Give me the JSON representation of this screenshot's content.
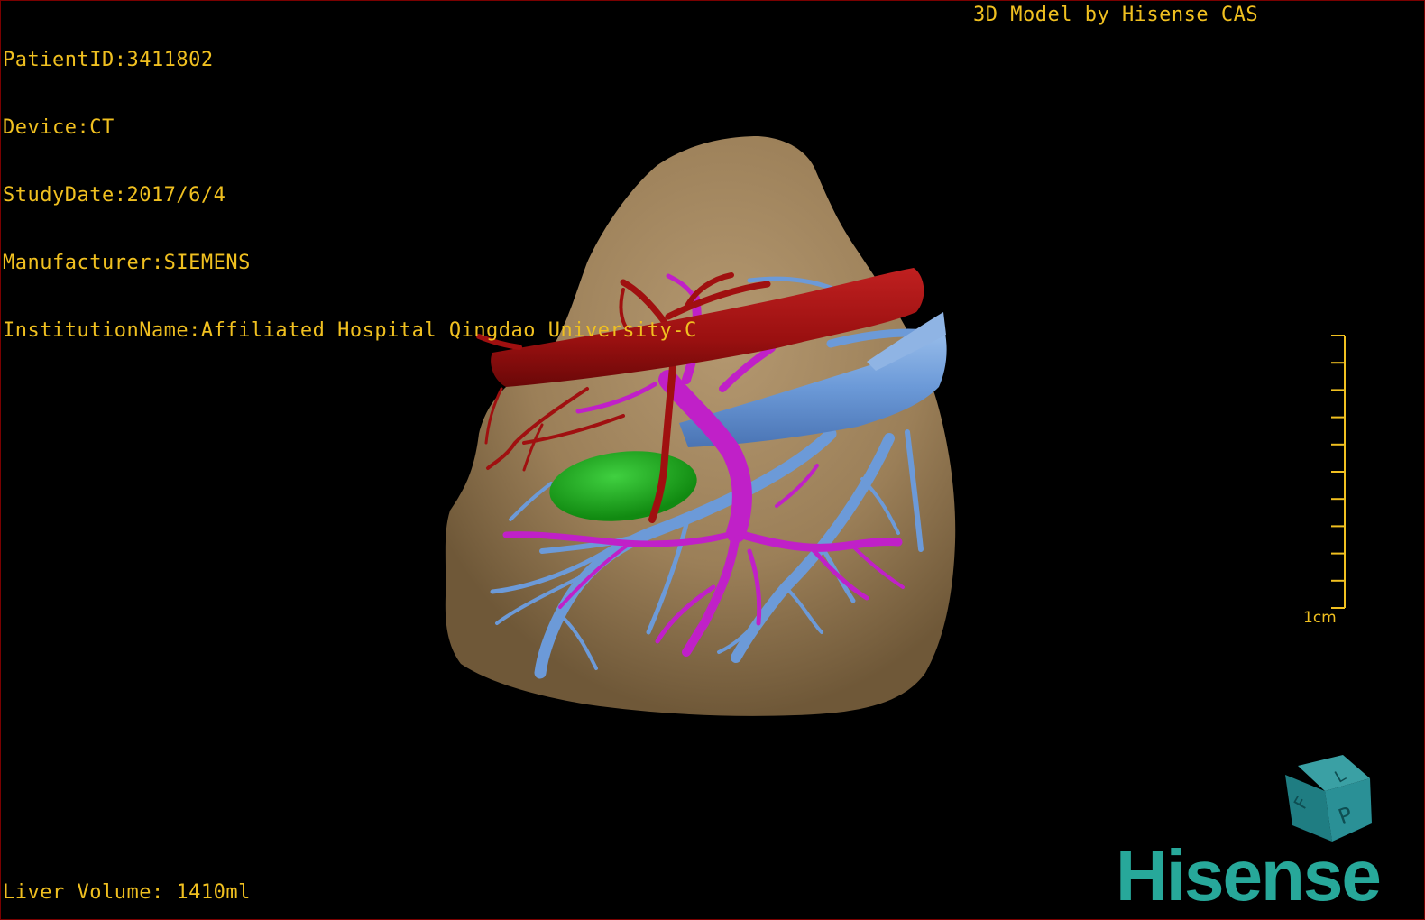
{
  "patient_info": {
    "patient_id": "PatientID:3411802",
    "device": "Device:CT",
    "study_date": "StudyDate:2017/6/4",
    "manufacturer": "Manufacturer:SIEMENS",
    "institution": "InstitutionName:Affiliated Hospital Qingdao University-C"
  },
  "model_credit": "3D Model by Hisense CAS",
  "liver_volume": "Liver Volume: 1410ml",
  "scale_bar": {
    "label": "1cm",
    "divisions": 10
  },
  "orientation_cube": {
    "face_labels": [
      "F",
      "L",
      "P"
    ]
  },
  "brand_logo": "Hisense",
  "colors": {
    "text": "#f0c020",
    "liver": "#9b7f58",
    "artery": "#a01010",
    "portal_vein": "#c020c8",
    "hepatic_vein": "#6c9ad8",
    "gallbladder": "#1aa01a",
    "brand": "#27a89a"
  }
}
